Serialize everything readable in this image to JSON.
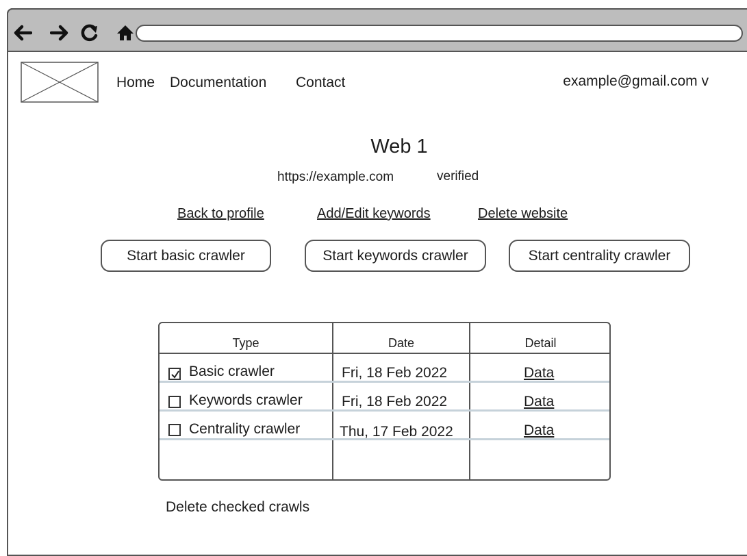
{
  "nav": {
    "home": "Home",
    "documentation": "Documentation",
    "contact": "Contact",
    "account": "example@gmail.com v"
  },
  "site": {
    "title": "Web 1",
    "url": "https://example.com",
    "status": "verified"
  },
  "actions": {
    "back": "Back to profile",
    "keywords": "Add/Edit keywords",
    "delete": "Delete website"
  },
  "crawlers": {
    "basic": "Start basic crawler",
    "keywords": "Start keywords crawler",
    "centrality": "Start centrality crawler"
  },
  "table": {
    "headers": [
      "Type",
      "Date",
      "Detail"
    ],
    "rows": [
      {
        "type": "Basic crawler",
        "date": "Fri, 18 Feb 2022",
        "detail": "Data",
        "checked": true
      },
      {
        "type": "Keywords crawler",
        "date": "Fri, 18 Feb 2022",
        "detail": "Data",
        "checked": false
      },
      {
        "type": "Centrality crawler",
        "date": "Thu, 17 Feb 2022",
        "detail": "Data",
        "checked": false
      }
    ]
  },
  "footer": {
    "delete_checked": "Delete checked crawls"
  },
  "icons": {
    "back": "arrow-left-icon",
    "forward": "arrow-right-icon",
    "reload": "reload-icon",
    "home": "home-icon",
    "logo": "image-placeholder"
  }
}
